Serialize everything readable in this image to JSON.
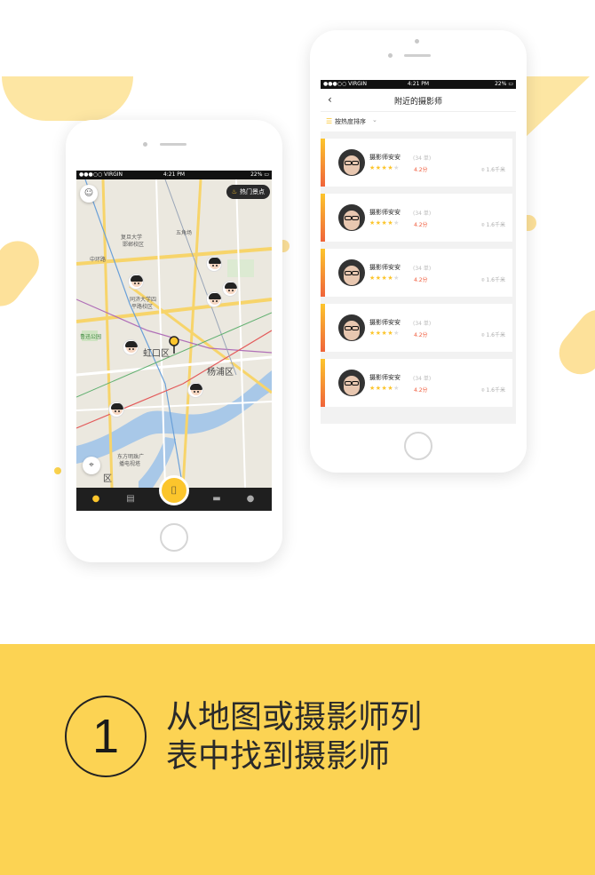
{
  "decor": {
    "accent": "#fcc52c",
    "banner_color": "#fcd353"
  },
  "map_phone": {
    "status": {
      "carrier": "●●●○○ VIRGIN ",
      "time": "4:21 PM",
      "battery": "22% ▭"
    },
    "hot_spots_label": "热门景点",
    "hot_spots_icon": "flame-icon",
    "map_labels": {
      "fudan": "复旦大学",
      "handan": "邯郸校区",
      "wujiaochang": "五角场",
      "zhonghuan": "中环路",
      "tongji": "同济大学四",
      "siping": "平路校区",
      "luxun": "鲁迅公园",
      "hongkou": "虹口区",
      "yangpu": "杨浦区",
      "oriental1": "东方明珠广",
      "oriental2": "播电视塔",
      "qu": "区"
    },
    "tabs": [
      "location-icon",
      "list-icon",
      "scan-icon",
      "message-icon",
      "user-icon"
    ]
  },
  "list_phone": {
    "status": {
      "carrier": "●●●○○ VIRGIN ",
      "time": "4:21 PM",
      "battery": "22% ▭"
    },
    "title": "附近的摄影师",
    "back": "‹",
    "sort_label": "按热度排序",
    "photographers": [
      {
        "name": "摄影师安安",
        "orders": "(34 单)",
        "rating": 4,
        "score": "4.2分",
        "distance": "1.6千米"
      },
      {
        "name": "摄影师安安",
        "orders": "(34 单)",
        "rating": 4,
        "score": "4.2分",
        "distance": "1.6千米"
      },
      {
        "name": "摄影师安安",
        "orders": "(34 单)",
        "rating": 4,
        "score": "4.2分",
        "distance": "1.6千米"
      },
      {
        "name": "摄影师安安",
        "orders": "(34 单)",
        "rating": 4,
        "score": "4.2分",
        "distance": "1.6千米"
      },
      {
        "name": "摄影师安安",
        "orders": "(34 单)",
        "rating": 4,
        "score": "4.2分",
        "distance": "1.6千米"
      }
    ]
  },
  "step": {
    "number": "1",
    "line1": "从地图或摄影师列",
    "line2": "表中找到摄影师"
  }
}
